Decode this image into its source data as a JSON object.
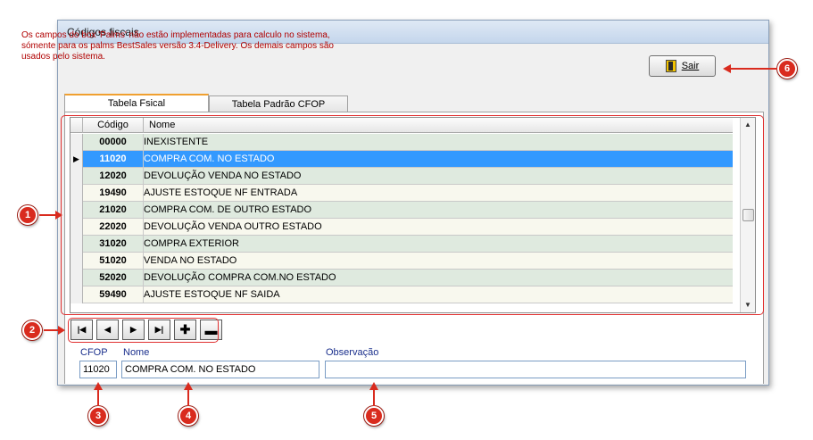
{
  "window": {
    "title": "Códigos fiscais"
  },
  "info_lines": [
    "Os campos do box 'Palms' não estão implementadas  para calculo no sistema,",
    "sómente para os palms BestSales versão 3.4-Delivery.  Os demais campos são",
    "usados pelo sistema."
  ],
  "sair_button": {
    "label": "Sair"
  },
  "tabs": [
    {
      "label": "Tabela Fsical"
    },
    {
      "label": "Tabela Padrão CFOP"
    }
  ],
  "grid": {
    "columns": {
      "code": "Código",
      "name": "Nome"
    },
    "selected_indicator": "▶",
    "rows": [
      {
        "code": "00000",
        "name": "INEXISTENTE"
      },
      {
        "code": "11020",
        "name": "COMPRA COM. NO ESTADO"
      },
      {
        "code": "12020",
        "name": "DEVOLUÇÃO VENDA NO ESTADO"
      },
      {
        "code": "19490",
        "name": "AJUSTE ESTOQUE NF ENTRADA"
      },
      {
        "code": "21020",
        "name": "COMPRA COM. DE OUTRO ESTADO"
      },
      {
        "code": "22020",
        "name": "DEVOLUÇÃO VENDA OUTRO ESTADO"
      },
      {
        "code": "31020",
        "name": "COMPRA EXTERIOR"
      },
      {
        "code": "51020",
        "name": "VENDA NO ESTADO"
      },
      {
        "code": "52020",
        "name": "DEVOLUÇÃO COMPRA COM.NO ESTADO"
      },
      {
        "code": "59490",
        "name": "AJUSTE ESTOQUE NF SAIDA"
      }
    ]
  },
  "form": {
    "cfop_label": "CFOP",
    "cfop_value": "11020",
    "nome_label": "Nome",
    "nome_value": "COMPRA COM. NO ESTADO",
    "obs_label": "Observação",
    "obs_value": ""
  },
  "callouts": [
    "1",
    "2",
    "3",
    "4",
    "5",
    "6"
  ],
  "colors": {
    "callout": "#d92b1e",
    "selection": "#3399ff",
    "info_text": "#b00000",
    "label_text": "#1a2f8c"
  }
}
